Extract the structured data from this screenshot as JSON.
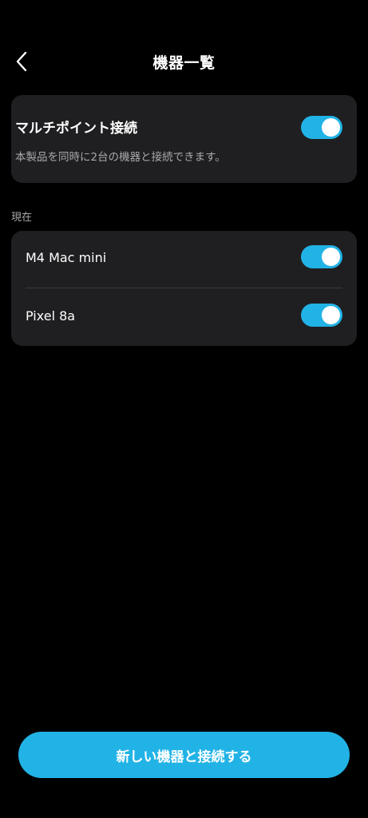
{
  "header": {
    "title": "機器一覧",
    "back_icon": "chevron-left-icon"
  },
  "multipoint": {
    "title": "マルチポイント接続",
    "description": "本製品を同時に2台の機器と接続できます。",
    "enabled": true
  },
  "current": {
    "section_label": "現在",
    "devices": [
      {
        "name": "M4 Mac mini",
        "connected": true
      },
      {
        "name": "Pixel 8a",
        "connected": true
      }
    ]
  },
  "footer": {
    "connect_new_label": "新しい機器と接続する"
  },
  "colors": {
    "accent": "#22b3e6",
    "background": "#000000",
    "card": "#1f1f21",
    "secondary_text": "#a9a9ad"
  }
}
